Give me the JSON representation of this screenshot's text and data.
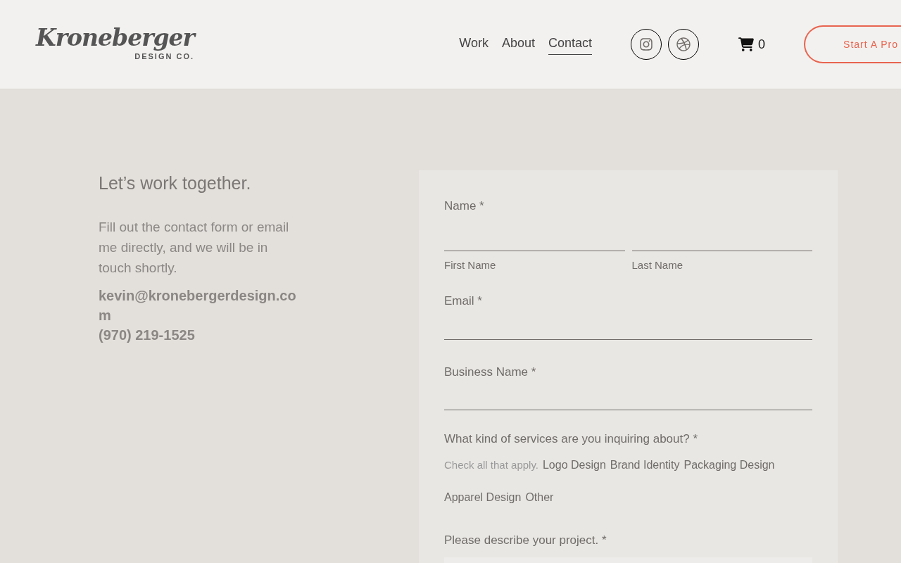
{
  "logo": {
    "script": "Kroneberger",
    "sub": "DESIGN CO."
  },
  "nav": [
    {
      "label": "Work",
      "selected": false
    },
    {
      "label": "About",
      "selected": false
    },
    {
      "label": "Contact",
      "selected": true
    }
  ],
  "cart_count": "0",
  "cta": "Start A Pro",
  "intro": {
    "heading": "Let’s work together.",
    "body": "Fill out the contact form or email me directly, and we will be in touch shortly.",
    "email": "kevin@kronebergerdesign.com",
    "phone": "(970) 219-1525"
  },
  "form": {
    "name_label": "Name *",
    "first_name": "First Name",
    "last_name": "Last Name",
    "email_label": "Email *",
    "business_label": "Business Name *",
    "services_label": "What kind of services are you inquiring about? *",
    "services_hint": "Check all that apply.",
    "services": [
      "Logo Design",
      "Brand Identity",
      "Packaging Design",
      "Apparel Design",
      "Other"
    ],
    "project_label": "Please describe your project. *"
  }
}
